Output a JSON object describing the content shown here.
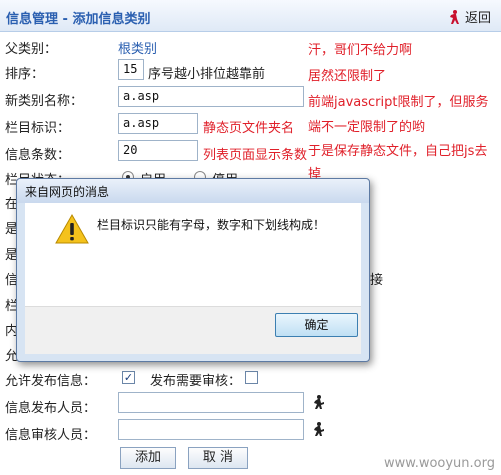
{
  "header": {
    "title": "信息管理 - 添加信息类别",
    "return_label": "返回",
    "return_icon": "return-icon"
  },
  "form": {
    "parent_label": "父类别：",
    "parent_value": "根类别",
    "order_label": "排序：",
    "order_value": "15",
    "order_hint": "序号越小排位越靠前",
    "name_label": "新类别名称：",
    "name_value": "a.asp",
    "column_id_label": "栏目标识：",
    "column_id_value": "a.asp",
    "column_id_hint": "静态页文件夹名",
    "count_label": "信息条数：",
    "count_value": "20",
    "count_hint": "列表页面显示条数",
    "status_label": "栏目状态：",
    "status_opt1": "启用",
    "status_opt2": "停用",
    "partial_label_1": "在导",
    "partial_label_2": "是否",
    "partial_label_3": "是否",
    "partial_label_4": "信息",
    "partial_label_5": "栏目",
    "partial_label_6": "内容",
    "partial_label_7": "允许",
    "partial_right_1": "接",
    "allow_publish_label": "允许发布信息：",
    "need_review_label": "发布需要审核：",
    "publisher_label": "信息发布人员：",
    "publisher_value": "",
    "reviewer_label": "信息审核人员：",
    "reviewer_value": "",
    "add_button": "添加",
    "cancel_button": "取 消"
  },
  "annotations": {
    "line1": "汗，哥们不给力啊",
    "line2": "居然还限制了",
    "line3": "前端javascript限制了，但服务",
    "line4": "端不一定限制了的哟",
    "line5": "于是保存静态文件，自己把js去",
    "line6": "掉"
  },
  "dialog": {
    "title": "来自网页的消息",
    "message": "栏目标识只能有字母，数字和下划线构成！",
    "ok_label": "确定",
    "icon": "warning-icon"
  },
  "watermark": "www.wooyun.org",
  "colors": {
    "title_blue": "#2a5fb0",
    "annotation_red": "#e0202a"
  }
}
